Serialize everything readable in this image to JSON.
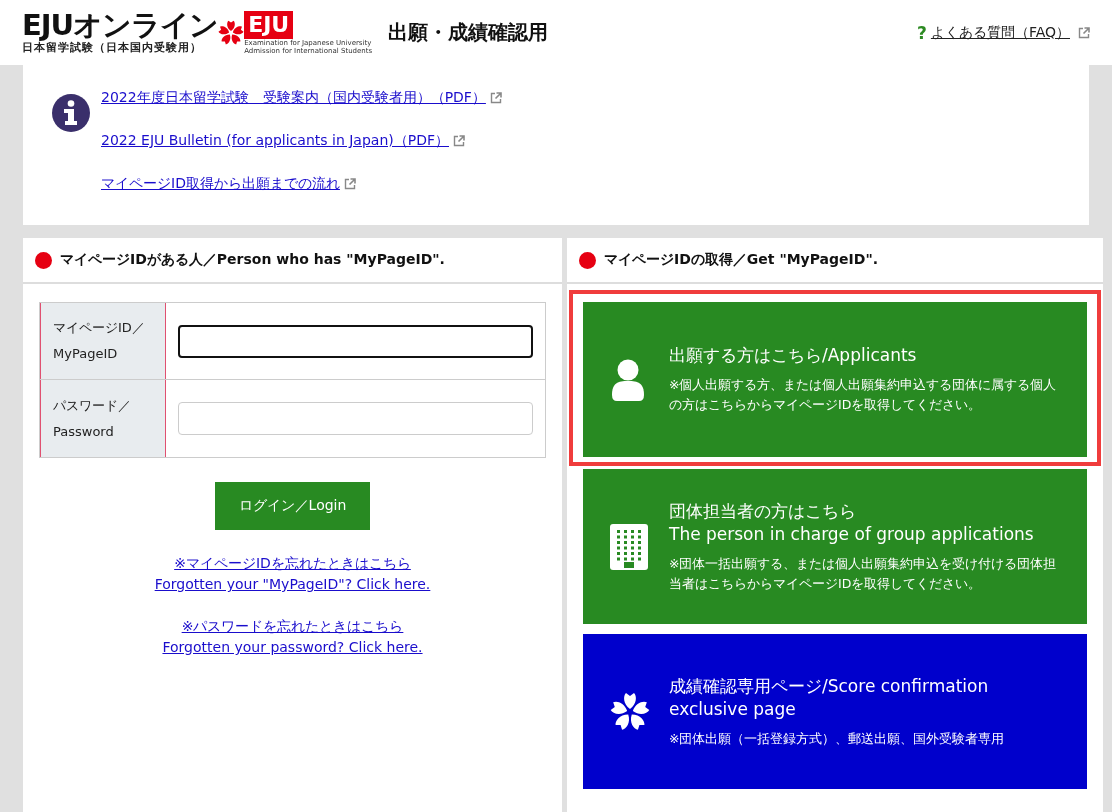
{
  "header": {
    "logo_title": "EJUオンライン",
    "logo_subtitle": "日本留学試験（日本国内受験用）",
    "badge_text": "EJU",
    "badge_caption": [
      "Examination for Japanese University",
      "Admission for International Students"
    ],
    "page_title": "出願・成績確認用",
    "faq_mark": "?",
    "faq_link": "よくある質問（FAQ）"
  },
  "info": {
    "links": [
      "2022年度日本留学試験　受験案内（国内受験者用）（PDF）",
      "2022 EJU Bulletin (for applicants in Japan)（PDF）",
      "マイページID取得から出願までの流れ"
    ]
  },
  "login": {
    "heading": "マイページIDがある人／Person who has \"MyPageID\".",
    "fields": [
      {
        "label": [
          "マイページID／",
          "MyPageID"
        ],
        "focused": true
      },
      {
        "label": [
          "パスワード／",
          "Password"
        ],
        "focused": false
      }
    ],
    "button": "ログイン／Login",
    "help_links": [
      [
        "※マイページIDを忘れたときはこちら",
        "Forgotten your \"MyPageID\"? Click here."
      ],
      [
        "※パスワードを忘れたときはこちら",
        "Forgotten your password? Click here."
      ]
    ]
  },
  "register": {
    "heading": "マイページIDの取得／Get \"MyPageID\".",
    "cards": [
      {
        "kind": "person",
        "color": "#288a22",
        "highlighted": true,
        "title": [
          "出願する方はこちら/Applicants"
        ],
        "note": "※個人出願する方、または個人出願集約申込する団体に属する個人の方はこちらからマイページIDを取得してください。"
      },
      {
        "kind": "building",
        "color": "#288a22",
        "highlighted": false,
        "title": [
          "団体担当者の方はこちら",
          "The person in charge of group applications"
        ],
        "note": "※団体一括出願する、または個人出願集約申込を受け付ける団体担当者はこちらからマイページIDを取得してください。"
      },
      {
        "kind": "flower",
        "color": "#0000cc",
        "highlighted": false,
        "title": [
          "成績確認専用ページ/Score confirmation exclusive page"
        ],
        "note": "※団体出願（一括登録方式）、郵送出願、国外受験者専用"
      }
    ]
  }
}
